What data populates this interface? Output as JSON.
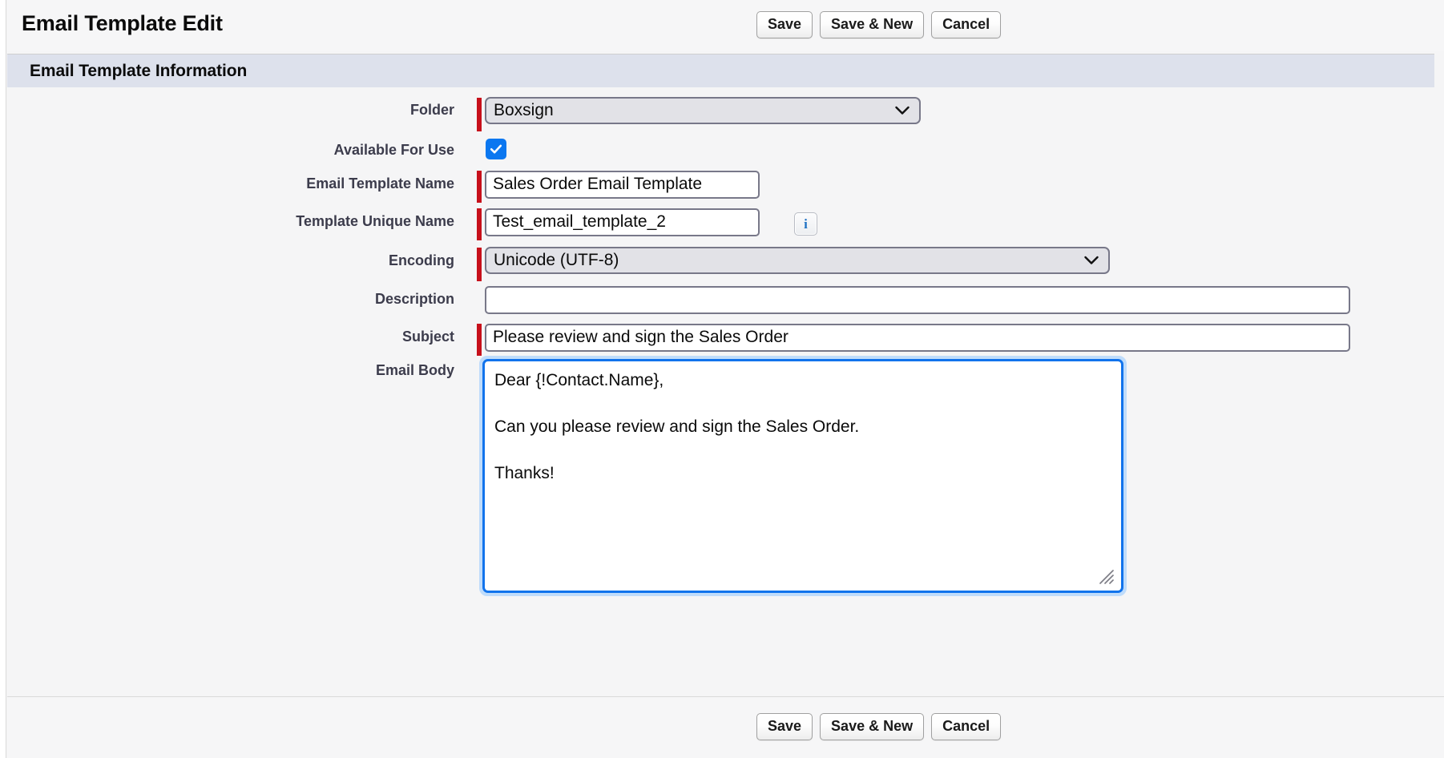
{
  "header": {
    "title": "Email Template Edit",
    "buttons": [
      {
        "label": "Save",
        "name": "save-button-top"
      },
      {
        "label": "Save & New",
        "name": "save-and-new-button-top"
      },
      {
        "label": "Cancel",
        "name": "cancel-button-top"
      }
    ]
  },
  "section": {
    "title": "Email Template Information"
  },
  "fields": {
    "folder": {
      "label": "Folder",
      "value": "Boxsign",
      "required": true,
      "options": [
        "Boxsign"
      ]
    },
    "available_for_use": {
      "label": "Available For Use",
      "checked": true,
      "required": false
    },
    "email_template_name": {
      "label": "Email Template Name",
      "value": "Sales Order Email Template",
      "placeholder": "",
      "required": true
    },
    "template_unique_name": {
      "label": "Template Unique Name",
      "value": "Test_email_template_2",
      "placeholder": "",
      "required": true,
      "info_icon": "info-icon",
      "info_glyph": "i"
    },
    "encoding": {
      "label": "Encoding",
      "value": "Unicode (UTF-8)",
      "required": true,
      "options": [
        "Unicode (UTF-8)"
      ]
    },
    "description": {
      "label": "Description",
      "value": "",
      "placeholder": "",
      "required": false
    },
    "subject": {
      "label": "Subject",
      "value": "Please review and sign the Sales Order",
      "placeholder": "",
      "required": true
    },
    "email_body": {
      "label": "Email Body",
      "value": "Dear {!Contact.Name},\n\nCan you please review and sign the Sales Order.\n\nThanks!",
      "placeholder": "",
      "required": false,
      "focused": true
    }
  },
  "footer": {
    "buttons": [
      {
        "label": "Save",
        "name": "save-button-bottom"
      },
      {
        "label": "Save & New",
        "name": "save-and-new-button-bottom"
      },
      {
        "label": "Cancel",
        "name": "cancel-button-bottom"
      }
    ]
  },
  "colors": {
    "required_bar": "#c7101b",
    "section_band": "#dde1ec",
    "checkbox_blue": "#0b77f0",
    "focus_border": "#1173ec",
    "focus_glow": "#bfdcfb",
    "label_text": "#3c3c4c",
    "page_bg": "#f5f5f6"
  }
}
